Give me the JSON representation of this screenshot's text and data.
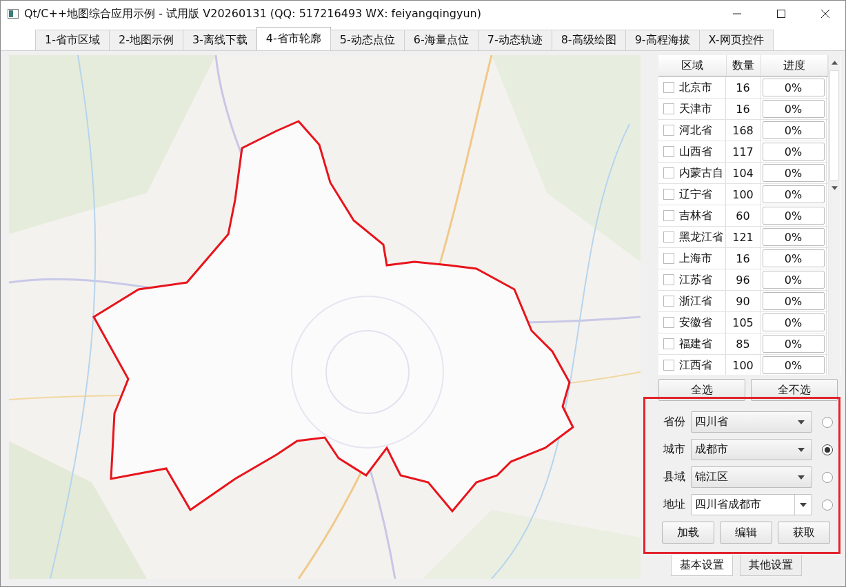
{
  "window": {
    "title": "Qt/C++地图综合应用示例 - 试用版 V20260131 (QQ: 517216493 WX: feiyangqingyun)"
  },
  "tabs": [
    {
      "label": "1-省市区域",
      "selected": false
    },
    {
      "label": "2-地图示例",
      "selected": false
    },
    {
      "label": "3-离线下载",
      "selected": false
    },
    {
      "label": "4-省市轮廓",
      "selected": true
    },
    {
      "label": "5-动态点位",
      "selected": false
    },
    {
      "label": "6-海量点位",
      "selected": false
    },
    {
      "label": "7-动态轨迹",
      "selected": false
    },
    {
      "label": "8-高级绘图",
      "selected": false
    },
    {
      "label": "9-高程海拔",
      "selected": false
    },
    {
      "label": "X-网页控件",
      "selected": false
    }
  ],
  "map": {
    "kind": "picture"
  },
  "table": {
    "columns": [
      "区域",
      "数量",
      "进度"
    ],
    "rows": [
      {
        "region": "北京市",
        "count": "16",
        "progress": "0%",
        "level": 0,
        "checked": false
      },
      {
        "region": "天津市",
        "count": "16",
        "progress": "0%",
        "level": 0,
        "checked": false
      },
      {
        "region": "河北省",
        "count": "168",
        "progress": "0%",
        "level": 0,
        "checked": false
      },
      {
        "region": "山西省",
        "count": "117",
        "progress": "0%",
        "level": 0,
        "checked": false
      },
      {
        "region": "内蒙古自",
        "count": "104",
        "progress": "0%",
        "level": 0,
        "checked": false
      },
      {
        "region": "辽宁省",
        "count": "100",
        "progress": "0%",
        "level": 0,
        "checked": false
      },
      {
        "region": "吉林省",
        "count": "60",
        "progress": "0%",
        "level": 0,
        "checked": false
      },
      {
        "region": "黑龙江省",
        "count": "121",
        "progress": "0%",
        "level": 0,
        "checked": false
      },
      {
        "region": "上海市",
        "count": "16",
        "progress": "0%",
        "level": 0,
        "checked": false
      },
      {
        "region": "江苏省",
        "count": "96",
        "progress": "0%",
        "level": 0,
        "checked": false
      },
      {
        "region": "浙江省",
        "count": "90",
        "progress": "0%",
        "level": 0,
        "checked": false
      },
      {
        "region": "安徽省",
        "count": "105",
        "progress": "0%",
        "level": 0,
        "checked": false
      },
      {
        "region": "福建省",
        "count": "85",
        "progress": "0%",
        "level": 0,
        "checked": false
      },
      {
        "region": "江西省",
        "count": "100",
        "progress": "0%",
        "level": 0,
        "checked": false
      }
    ]
  },
  "select_buttons": [
    "全选",
    "全不选"
  ],
  "form": [
    {
      "label": "省份",
      "value": "四川省",
      "kind": "combo",
      "selected": false
    },
    {
      "label": "城市",
      "value": "成都市",
      "kind": "combo",
      "selected": true
    },
    {
      "label": "县域",
      "value": "锦江区",
      "kind": "combo",
      "selected": false
    },
    {
      "label": "地址",
      "value": "四川省成都市",
      "kind": "editable",
      "selected": false
    }
  ],
  "action_buttons": [
    "加载",
    "编辑",
    "获取"
  ],
  "bottom_tabs": [
    {
      "label": "基本设置",
      "selected": true
    },
    {
      "label": "其他设置",
      "selected": false
    }
  ]
}
